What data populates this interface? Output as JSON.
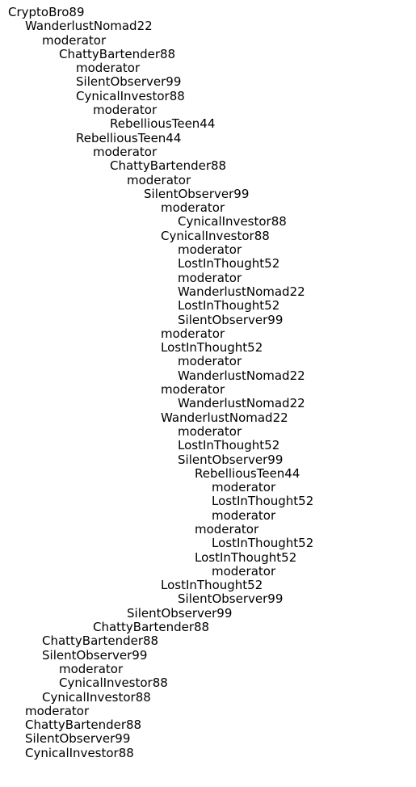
{
  "thread": [
    {
      "depth": 0,
      "label": "CryptoBro89"
    },
    {
      "depth": 1,
      "label": "WanderlustNomad22"
    },
    {
      "depth": 2,
      "label": "moderator"
    },
    {
      "depth": 3,
      "label": "ChattyBartender88"
    },
    {
      "depth": 4,
      "label": "moderator"
    },
    {
      "depth": 4,
      "label": "SilentObserver99"
    },
    {
      "depth": 4,
      "label": "CynicalInvestor88"
    },
    {
      "depth": 5,
      "label": "moderator"
    },
    {
      "depth": 6,
      "label": "RebelliousTeen44"
    },
    {
      "depth": 4,
      "label": "RebelliousTeen44"
    },
    {
      "depth": 5,
      "label": "moderator"
    },
    {
      "depth": 6,
      "label": "ChattyBartender88"
    },
    {
      "depth": 7,
      "label": "moderator"
    },
    {
      "depth": 8,
      "label": "SilentObserver99"
    },
    {
      "depth": 9,
      "label": "moderator"
    },
    {
      "depth": 10,
      "label": "CynicalInvestor88"
    },
    {
      "depth": 9,
      "label": "CynicalInvestor88"
    },
    {
      "depth": 10,
      "label": "moderator"
    },
    {
      "depth": 10,
      "label": "LostInThought52"
    },
    {
      "depth": 10,
      "label": "moderator"
    },
    {
      "depth": 10,
      "label": "WanderlustNomad22"
    },
    {
      "depth": 10,
      "label": "LostInThought52"
    },
    {
      "depth": 10,
      "label": "SilentObserver99"
    },
    {
      "depth": 9,
      "label": "moderator"
    },
    {
      "depth": 9,
      "label": "LostInThought52"
    },
    {
      "depth": 10,
      "label": "moderator"
    },
    {
      "depth": 10,
      "label": "WanderlustNomad22"
    },
    {
      "depth": 9,
      "label": "moderator"
    },
    {
      "depth": 10,
      "label": "WanderlustNomad22"
    },
    {
      "depth": 9,
      "label": "WanderlustNomad22"
    },
    {
      "depth": 10,
      "label": "moderator"
    },
    {
      "depth": 10,
      "label": "LostInThought52"
    },
    {
      "depth": 10,
      "label": "SilentObserver99"
    },
    {
      "depth": 11,
      "label": "RebelliousTeen44"
    },
    {
      "depth": 12,
      "label": "moderator"
    },
    {
      "depth": 12,
      "label": "LostInThought52"
    },
    {
      "depth": 12,
      "label": "moderator"
    },
    {
      "depth": 11,
      "label": "moderator"
    },
    {
      "depth": 12,
      "label": "LostInThought52"
    },
    {
      "depth": 11,
      "label": "LostInThought52"
    },
    {
      "depth": 12,
      "label": "moderator"
    },
    {
      "depth": 9,
      "label": "LostInThought52"
    },
    {
      "depth": 10,
      "label": "SilentObserver99"
    },
    {
      "depth": 7,
      "label": "SilentObserver99"
    },
    {
      "depth": 5,
      "label": "ChattyBartender88"
    },
    {
      "depth": 2,
      "label": "ChattyBartender88"
    },
    {
      "depth": 2,
      "label": "SilentObserver99"
    },
    {
      "depth": 3,
      "label": "moderator"
    },
    {
      "depth": 3,
      "label": "CynicalInvestor88"
    },
    {
      "depth": 2,
      "label": "CynicalInvestor88"
    },
    {
      "depth": 1,
      "label": "moderator"
    },
    {
      "depth": 1,
      "label": "ChattyBartender88"
    },
    {
      "depth": 1,
      "label": "SilentObserver99"
    },
    {
      "depth": 1,
      "label": "CynicalInvestor88"
    }
  ]
}
